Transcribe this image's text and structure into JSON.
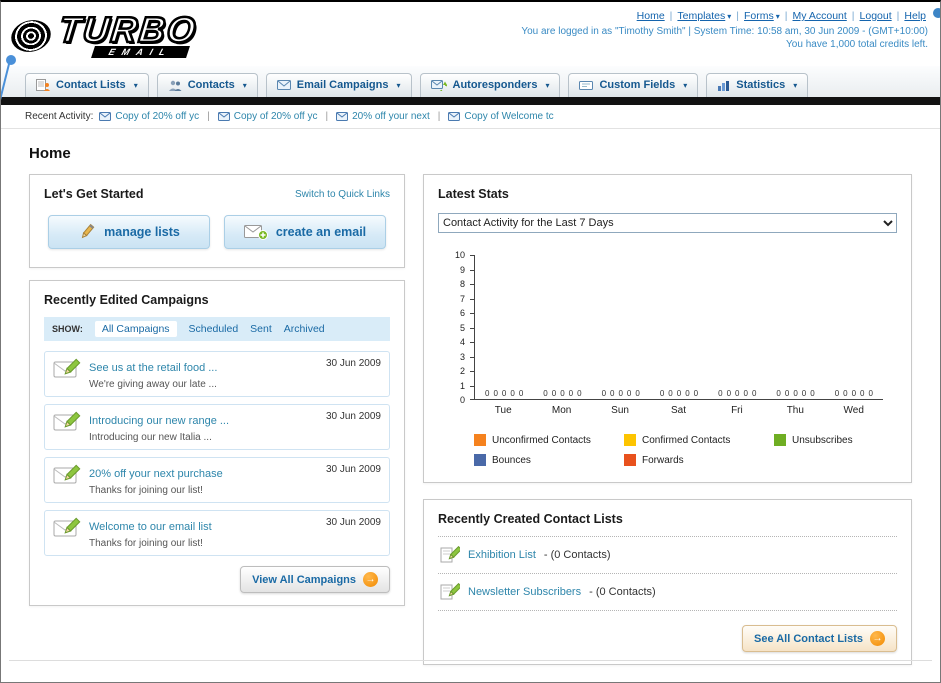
{
  "header": {
    "logo": {
      "main": "TURBO",
      "sub": "EMAIL"
    },
    "nav_links": [
      {
        "label": "Home"
      },
      {
        "label": "Templates"
      },
      {
        "label": "Forms"
      },
      {
        "label": "My Account"
      },
      {
        "label": "Logout"
      },
      {
        "label": "Help"
      }
    ],
    "login_info": "You are logged in as \"Timothy Smith\" | System Time: 10:58 am, 30 Jun 2009 - (GMT+10:00)",
    "credits_info": "You have 1,000 total credits left."
  },
  "main_nav": {
    "tabs": [
      {
        "label": "Contact Lists"
      },
      {
        "label": "Contacts"
      },
      {
        "label": "Email Campaigns"
      },
      {
        "label": "Autoresponders"
      },
      {
        "label": "Custom Fields"
      },
      {
        "label": "Statistics"
      }
    ]
  },
  "recent_activity": {
    "label": "Recent Activity:",
    "items": [
      "Copy of 20% off yc",
      "Copy of 20% off yc",
      "20% off your next",
      "Copy of Welcome tc"
    ]
  },
  "page_title": "Home",
  "get_started": {
    "title": "Let's Get Started",
    "switch_link": "Switch to Quick Links",
    "manage_lists_label": "manage lists",
    "create_email_label": "create an email"
  },
  "campaigns": {
    "title": "Recently Edited Campaigns",
    "show_label": "SHOW:",
    "filters": [
      "All Campaigns",
      "Scheduled",
      "Sent",
      "Archived"
    ],
    "active_filter": "All Campaigns",
    "rows": [
      {
        "title": "See us at the retail food ...",
        "subtitle": "We're giving away our late ...",
        "date": "30 Jun 2009"
      },
      {
        "title": "Introducing our new range ...",
        "subtitle": "Introducing our new Italia ...",
        "date": "30 Jun 2009"
      },
      {
        "title": "20% off your next purchase",
        "subtitle": "Thanks for joining our list!",
        "date": "30 Jun 2009"
      },
      {
        "title": "Welcome to our email list",
        "subtitle": "Thanks for joining our list!",
        "date": "30 Jun 2009"
      }
    ],
    "view_all_label": "View All Campaigns"
  },
  "stats": {
    "title": "Latest Stats",
    "dropdown_value": "Contact Activity for the Last 7 Days"
  },
  "contact_lists": {
    "title": "Recently Created Contact Lists",
    "items": [
      {
        "name": "Exhibition List",
        "detail": "- (0 Contacts)"
      },
      {
        "name": "Newsletter Subscribers",
        "detail": "- (0 Contacts)"
      }
    ],
    "see_all_label": "See All Contact Lists"
  },
  "chart_data": {
    "type": "bar",
    "title": "Contact Activity for the Last 7 Days",
    "categories": [
      "Tue",
      "Mon",
      "Sun",
      "Sat",
      "Fri",
      "Thu",
      "Wed"
    ],
    "series": [
      {
        "name": "Unconfirmed Contacts",
        "color": "#f5821f",
        "values": [
          0,
          0,
          0,
          0,
          0,
          0,
          0
        ]
      },
      {
        "name": "Confirmed Contacts",
        "color": "#fdc400",
        "values": [
          0,
          0,
          0,
          0,
          0,
          0,
          0
        ]
      },
      {
        "name": "Unsubscribes",
        "color": "#6fae23",
        "values": [
          0,
          0,
          0,
          0,
          0,
          0,
          0
        ]
      },
      {
        "name": "Bounces",
        "color": "#4a69a8",
        "values": [
          0,
          0,
          0,
          0,
          0,
          0,
          0
        ]
      },
      {
        "name": "Forwards",
        "color": "#e8511d",
        "values": [
          0,
          0,
          0,
          0,
          0,
          0,
          0
        ]
      }
    ],
    "ylim": [
      0,
      10
    ],
    "ytick_step": 1,
    "grid": false,
    "legend_position": "bottom",
    "xlabel": "",
    "ylabel": ""
  }
}
